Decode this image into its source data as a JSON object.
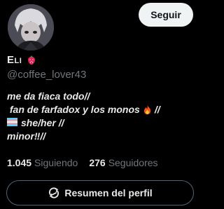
{
  "profile": {
    "display_name": "Eli",
    "name_emoji": "strawberry-icon",
    "handle": "@coffee_lover43",
    "follow_label": "Seguir"
  },
  "bio": {
    "line1": "me da fiaca todo//",
    "line2_text": "fan de farfadox y los monos",
    "line2_icon": "fire-icon",
    "line2_suffix": "//",
    "line3_icon": "transgender-flag-icon",
    "line3_text": "she/her //",
    "line4": "minor‼//"
  },
  "stats": {
    "following_count": "1.045",
    "following_label": "Siguiendo",
    "followers_count": "276",
    "followers_label": "Seguidores"
  },
  "summary": {
    "label": "Resumen del perfil",
    "icon": "sparkle-refresh-icon"
  },
  "colors": {
    "background": "#000000",
    "text": "#e7e9ea",
    "muted": "#71767b",
    "follow_bg": "#eff3f4",
    "border": "#536471"
  }
}
